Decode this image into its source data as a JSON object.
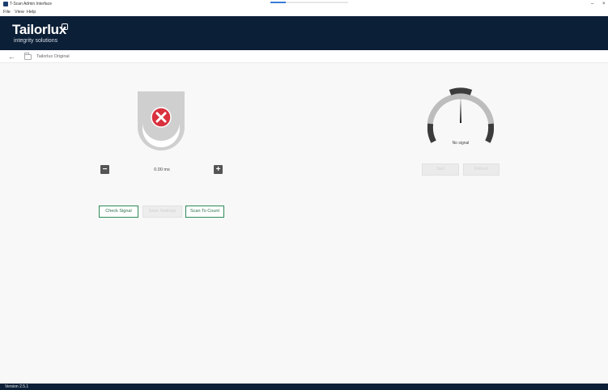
{
  "window": {
    "title": "T-Scan Admin Interface",
    "progress": 0.2,
    "controls": {
      "minimize": "–",
      "close": "×"
    }
  },
  "menu": {
    "items": [
      "File",
      "View",
      "Help"
    ]
  },
  "header": {
    "brand": "Tailorlux",
    "tagline": "integrity solutions"
  },
  "breadcrumb": {
    "label": "Tailorlux Original"
  },
  "status_panel": {
    "status_icon": "error-x-icon",
    "value": "0.00 ms",
    "minus_label": "−",
    "plus_label": "+",
    "buttons": {
      "check_signal": "Check Signal",
      "save_settings": "Save Settings",
      "scan_to_count": "Scan To Count"
    }
  },
  "gauge_panel": {
    "signal_text": "No signal",
    "buttons": {
      "start": "Start",
      "refresh": "Refresh"
    }
  },
  "footer": {
    "version": "Version 2.5.1"
  },
  "colors": {
    "brand_navy": "#0b1f37",
    "error_red": "#d9313e",
    "accent_green": "#2e8a57",
    "gauge_dark": "#3c3c3c",
    "gauge_light": "#bdbdbd"
  }
}
